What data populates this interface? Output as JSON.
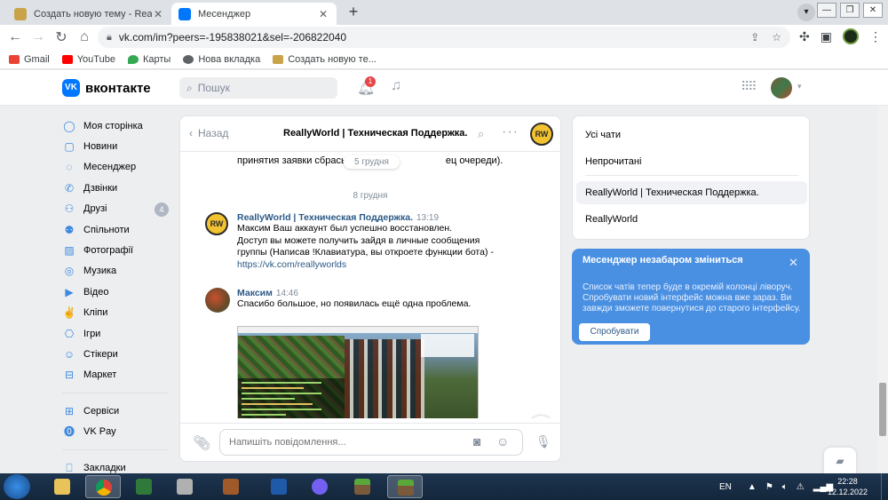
{
  "browser": {
    "tabs": [
      {
        "title": "Создать новую тему - ReallyWorld",
        "active": false
      },
      {
        "title": "Месенджер",
        "active": true
      }
    ],
    "url": "vk.com/im?peers=-195838021&sel=-206822040",
    "bookmarks": [
      "Gmail",
      "YouTube",
      "Карты",
      "Нова вкладка",
      "Создать новую те..."
    ]
  },
  "vk": {
    "logo": "вконтакте",
    "search_placeholder": "Пошук",
    "notification_count": "1"
  },
  "sidebar": {
    "items": [
      {
        "label": "Моя сторінка",
        "icon": "user-icon"
      },
      {
        "label": "Новини",
        "icon": "news-icon"
      },
      {
        "label": "Месенджер",
        "icon": "message-icon"
      },
      {
        "label": "Дзвінки",
        "icon": "phone-icon"
      },
      {
        "label": "Друзі",
        "icon": "friends-icon",
        "count": "4"
      },
      {
        "label": "Спільноти",
        "icon": "communities-icon"
      },
      {
        "label": "Фотографії",
        "icon": "photo-icon"
      },
      {
        "label": "Музика",
        "icon": "music-icon"
      },
      {
        "label": "Відео",
        "icon": "video-icon"
      },
      {
        "label": "Кліпи",
        "icon": "clips-icon"
      },
      {
        "label": "Ігри",
        "icon": "games-icon"
      },
      {
        "label": "Стікери",
        "icon": "stickers-icon"
      },
      {
        "label": "Маркет",
        "icon": "market-icon"
      }
    ],
    "items2": [
      {
        "label": "Сервіси",
        "icon": "services-icon"
      },
      {
        "label": "VK Pay",
        "icon": "vkpay-icon"
      }
    ],
    "items3": [
      {
        "label": "Закладки",
        "icon": "bookmark-icon"
      }
    ]
  },
  "chat": {
    "back_label": "Назад",
    "title": "ReallyWorld | Техническая Поддержка.",
    "prev_line": "принятия заявки сбрасы",
    "prev_tail": "ец очереди).",
    "floating_date": "5 грудня",
    "date_separator": "8 грудня",
    "messages": [
      {
        "author": "ReallyWorld | Техническая Поддержка.",
        "time": "13:19",
        "lines": [
          "Максим Ваш аккаунт был успешно восстановлен.",
          "Доступ вы можете получить зайдя в личные сообщения",
          "группы (Написав !Клавиатура, вы откроете функции бота) -"
        ],
        "link": "https://vk.com/reallyworlds"
      },
      {
        "author": "Максим",
        "time": "14:46",
        "lines": [
          "Спасибо большое, но появилась ещё одна проблема."
        ]
      }
    ],
    "avatar_text": "RW",
    "composer_placeholder": "Напишіть повідомлення..."
  },
  "filters": {
    "items": [
      "Усі чати",
      "Непрочитані",
      "ReallyWorld | Техническая Поддержка.",
      "ReallyWorld"
    ]
  },
  "promo": {
    "title": "Месенджер незабаром зміниться",
    "text": "Список чатів тепер буде в окремій колонці ліворуч. Спробувати новий інтерфейс можна вже зараз. Ви завжди зможете повернутися до старого інтерфейсу.",
    "button": "Спробувати"
  },
  "taskbar": {
    "lang": "EN",
    "time": "22:28",
    "date": "12.12.2022"
  }
}
